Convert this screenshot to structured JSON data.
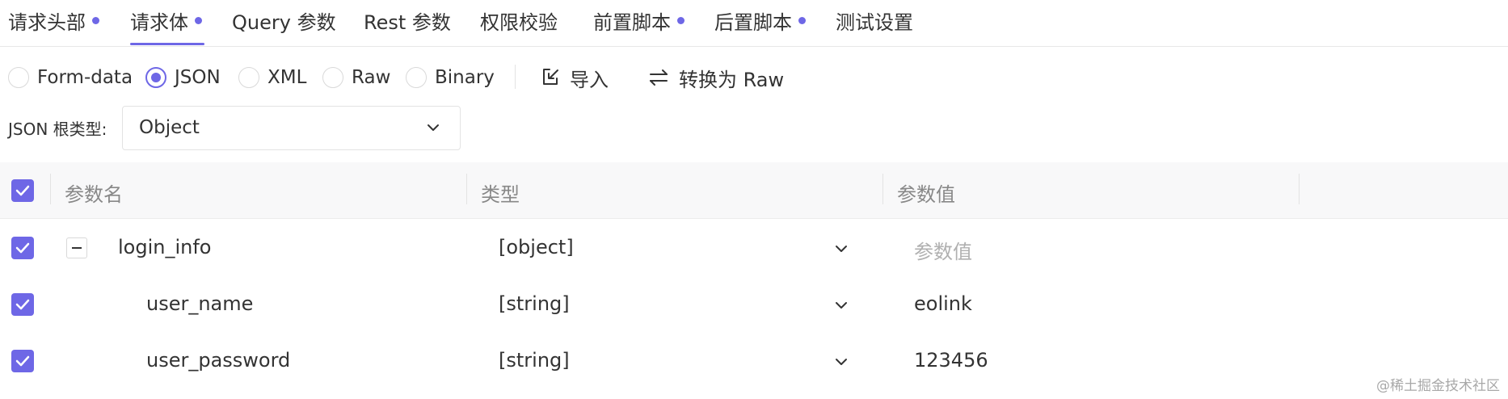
{
  "tabs": [
    {
      "label": "请求头部",
      "dot": true
    },
    {
      "label": "请求体",
      "dot": true,
      "active": true
    },
    {
      "label": "Query 参数",
      "dot": false
    },
    {
      "label": "Rest 参数",
      "dot": false
    },
    {
      "label": "权限校验",
      "dot": false
    },
    {
      "label": "前置脚本",
      "dot": true
    },
    {
      "label": "后置脚本",
      "dot": true
    },
    {
      "label": "测试设置",
      "dot": false
    }
  ],
  "body_types": {
    "options": [
      "Form-data",
      "JSON",
      "XML",
      "Raw",
      "Binary"
    ],
    "selected": "JSON"
  },
  "actions": {
    "import_label": "导入",
    "convert_label": "转换为 Raw"
  },
  "json_root": {
    "label": "JSON 根类型:",
    "value": "Object"
  },
  "table": {
    "headers": [
      "参数名",
      "类型",
      "参数值"
    ],
    "rows": [
      {
        "name": "login_info",
        "type": "[object]",
        "value": "参数值",
        "value_is_placeholder": true,
        "checked": true
      },
      {
        "name": "user_name",
        "type": "[string]",
        "value": "eolink",
        "value_is_placeholder": false,
        "checked": true
      },
      {
        "name": "user_password",
        "type": "[string]",
        "value": "123456",
        "value_is_placeholder": false,
        "checked": true
      }
    ]
  },
  "watermark": "@稀土掘金技术社区",
  "colors": {
    "accent": "#6e67e6",
    "placeholder": "#b0b0b0",
    "header_bg": "#f8f8f9"
  }
}
